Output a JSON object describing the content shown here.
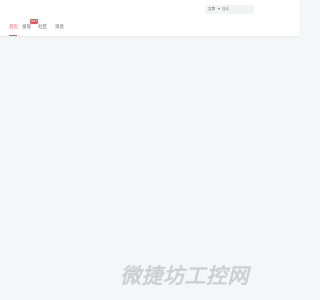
{
  "header": {
    "tabs": [
      {
        "label": "首页",
        "active": true
      },
      {
        "label": "发现"
      },
      {
        "label": "社区"
      },
      {
        "label": "消息"
      }
    ],
    "badge": {
      "text": "HOT"
    },
    "search": {
      "scope_label": "文章",
      "placeholder": "搜索"
    }
  },
  "watermark": {
    "text": "微捷坊工控网"
  },
  "colors": {
    "accent": "#e8535b",
    "background": "#f5f6f8",
    "header_bg": "#ffffff"
  }
}
